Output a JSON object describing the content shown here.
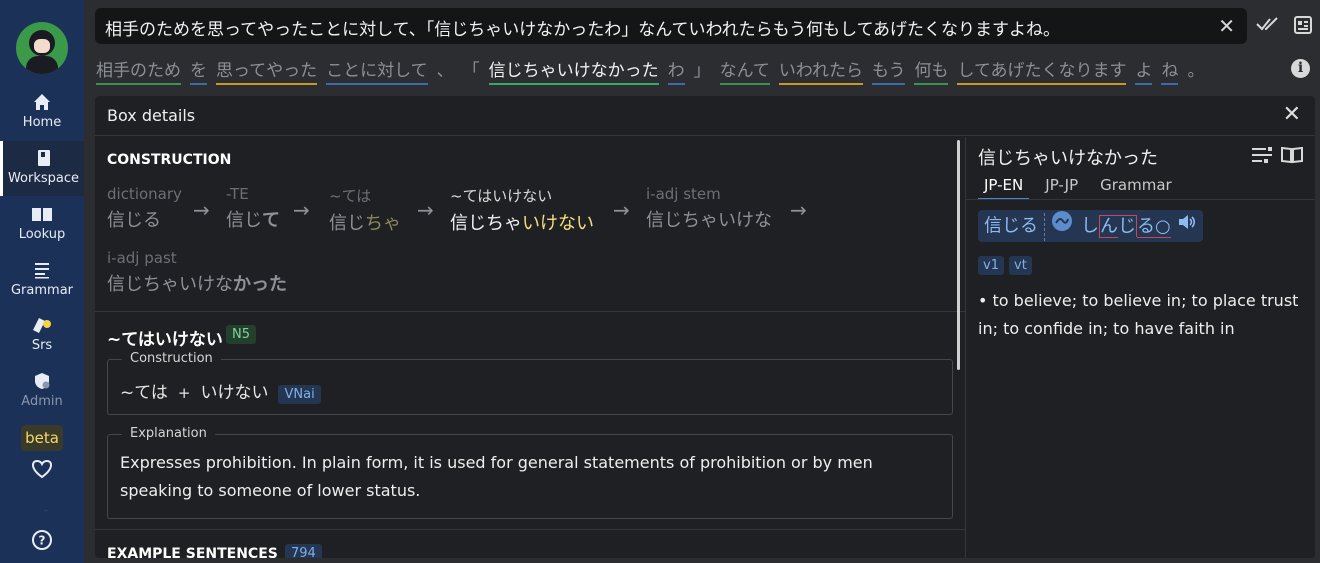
{
  "sidebar": {
    "items": [
      {
        "label": "Home",
        "icon": "home-icon"
      },
      {
        "label": "Workspace",
        "icon": "book-icon"
      },
      {
        "label": "Lookup",
        "icon": "open-book-icon"
      },
      {
        "label": "Grammar",
        "icon": "list-icon"
      },
      {
        "label": "Srs",
        "icon": "cards-icon"
      },
      {
        "label": "Admin",
        "icon": "admin-shield-icon"
      }
    ],
    "beta_label": "beta"
  },
  "sentence": {
    "text": "相手のためを思ってやったことに対して、「信じちゃいけなかったわ」なんていわれたらもう何もしてあげたくなりますよね。",
    "tokens": [
      {
        "text": "相手のため",
        "color": "#3f8f5a"
      },
      {
        "text": "を",
        "color": "#3a6aa8"
      },
      {
        "text": "思ってやった",
        "color": "#c49a2a"
      },
      {
        "text": "ことに対して",
        "color": "#3a6aa8"
      },
      {
        "text": "、",
        "color": ""
      },
      {
        "text": "「",
        "color": ""
      },
      {
        "text": "信じちゃいけなかった",
        "color": "#3aa86a"
      },
      {
        "text": "わ",
        "color": "#3a6aa8"
      },
      {
        "text": "」",
        "color": ""
      },
      {
        "text": "なんて",
        "color": "#3f8f5a"
      },
      {
        "text": "いわれたら",
        "color": "#c49a2a"
      },
      {
        "text": "もう",
        "color": "#3a6aa8"
      },
      {
        "text": "何も",
        "color": "#3f8f5a"
      },
      {
        "text": "してあげたくなります",
        "color": "#c49a2a"
      },
      {
        "text": "よ",
        "color": "#3a6aa8"
      },
      {
        "text": "ね",
        "color": "#3a6aa8"
      },
      {
        "text": "。",
        "color": ""
      }
    ]
  },
  "panel": {
    "title": "Box details",
    "construction": {
      "title": "CONSTRUCTION",
      "steps": [
        {
          "label": "dictionary",
          "base": "信じる",
          "emph": ""
        },
        {
          "label": "-TE",
          "base": "信じ",
          "emph": "て"
        },
        {
          "label": "~ては",
          "base": "信じ",
          "emph": "ちゃ"
        },
        {
          "label": "~てはいけない",
          "base": "信じちゃ",
          "emph": "いけない"
        },
        {
          "label": "i-adj stem",
          "base": "信じちゃいけな",
          "emph": ""
        },
        {
          "label": "i-adj past",
          "base": "信じちゃいけな",
          "emph": "かった"
        }
      ]
    },
    "grammar": {
      "title": "~てはいけない",
      "level": "N5",
      "construction_legend": "Construction",
      "part1": "~ては",
      "plus": "+",
      "part2": "いけない",
      "part2_tag": "VNai",
      "explanation_legend": "Explanation",
      "explanation": "Expresses prohibition. In plain form, it is used for general statements of prohibition or by men speaking to someone of lower status."
    },
    "examples": {
      "title": "EXAMPLE SENTENCES",
      "count": "794"
    }
  },
  "dictionary": {
    "word": "信じちゃいけなかった",
    "tabs": [
      "JP-EN",
      "JP-JP",
      "Grammar"
    ],
    "headword": "信じる",
    "reading_parts": [
      "し",
      "ん",
      "じ",
      "る"
    ],
    "reading_suffix": "○",
    "pos_tags": [
      "v1",
      "vt"
    ],
    "definition": "• to believe; to believe in; to place trust in; to confide in; to have faith in"
  }
}
